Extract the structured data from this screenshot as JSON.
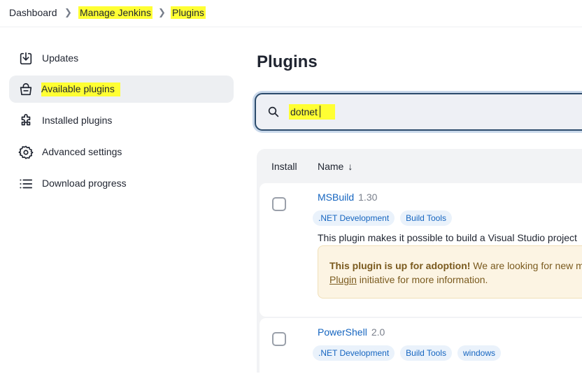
{
  "breadcrumb": {
    "items": [
      "Dashboard",
      "Manage Jenkins",
      "Plugins"
    ]
  },
  "sidebar": {
    "items": [
      {
        "label": "Updates",
        "icon": "download-icon"
      },
      {
        "label": "Available plugins",
        "icon": "shopping-bag-icon",
        "active": true
      },
      {
        "label": "Installed plugins",
        "icon": "puzzle-icon"
      },
      {
        "label": "Advanced settings",
        "icon": "gear-icon"
      },
      {
        "label": "Download progress",
        "icon": "list-icon"
      }
    ]
  },
  "main": {
    "title": "Plugins",
    "search": {
      "value": "dotnet",
      "icon": "search-icon"
    },
    "table": {
      "headers": {
        "install": "Install",
        "name": "Name",
        "sort_indicator": "↓"
      },
      "rows": [
        {
          "name": "MSBuild",
          "version": "1.30",
          "tags": [
            ".NET Development",
            "Build Tools"
          ],
          "description": "This plugin makes it possible to build a Visual Studio project",
          "notice": {
            "bold": "This plugin is up for adoption!",
            "text": " We are looking for new m",
            "link": "Plugin",
            "after": " initiative for more information."
          }
        },
        {
          "name": "PowerShell",
          "version": "2.0",
          "tags": [
            ".NET Development",
            "Build Tools",
            "windows"
          ]
        }
      ]
    }
  },
  "colors": {
    "highlight": "#ffff33",
    "link": "#1565c0",
    "notice_bg": "#fcf4e3"
  }
}
